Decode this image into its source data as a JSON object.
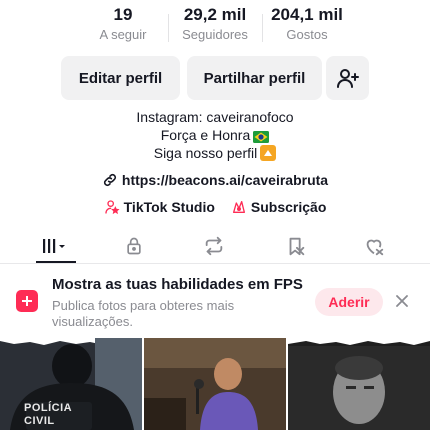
{
  "stats": [
    {
      "value": "19",
      "label": "A seguir"
    },
    {
      "value": "29,2 mil",
      "label": "Seguidores"
    },
    {
      "value": "204,1 mil",
      "label": "Gostos"
    }
  ],
  "buttons": {
    "edit_profile": "Editar perfil",
    "share_profile": "Partilhar perfil",
    "add_user_icon": "add-user-icon"
  },
  "bio": {
    "line1": "Instagram: caveiranofoco",
    "line2": "Força e Honra",
    "line2_emoji": "🇧🇷",
    "line3": "Siga nosso perfil",
    "line3_emoji": "🔼"
  },
  "link": {
    "icon": "link-icon",
    "text": "https://beacons.ai/caveirabruta"
  },
  "extras": [
    {
      "icon": "tiktok-studio-icon",
      "label": "TikTok Studio"
    },
    {
      "icon": "subscription-icon",
      "label": "Subscrição"
    }
  ],
  "tabs": [
    {
      "name": "videos-grid-icon",
      "active": true
    },
    {
      "name": "lock-icon",
      "active": false
    },
    {
      "name": "repost-icon",
      "active": false
    },
    {
      "name": "saved-icon",
      "active": false
    },
    {
      "name": "liked-icon",
      "active": false
    }
  ],
  "banner": {
    "title": "Mostra as tuas habilidades em FPS",
    "subtitle": "Publica fotos para obteres mais visualizações.",
    "cta": "Aderir",
    "close_icon": "close-icon",
    "accent": "#fe2c55"
  },
  "thumbnails": [
    {
      "label": "POLÍCIA CIVIL"
    },
    {
      "label": ""
    },
    {
      "label": ""
    }
  ]
}
